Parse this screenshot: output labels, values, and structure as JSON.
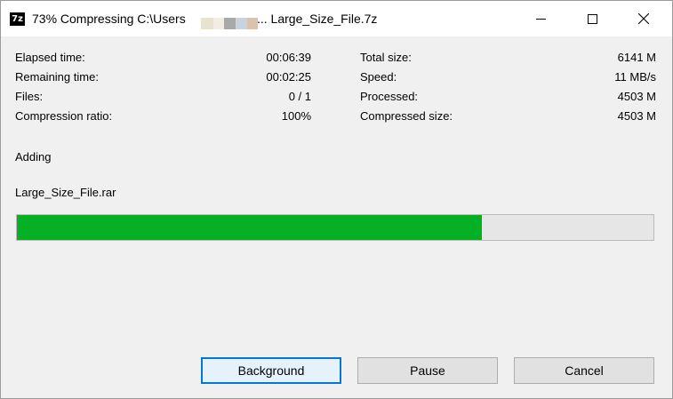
{
  "window": {
    "title_prefix": "73% Compressing C:\\Users",
    "title_suffix": "... Large_Size_File.7z",
    "app_icon_label": "7z",
    "icons": {
      "app": "7zip-app-icon",
      "minimize": "minimize-icon",
      "maximize": "maximize-icon",
      "close": "close-icon"
    }
  },
  "stats": {
    "left": [
      {
        "label": "Elapsed time:",
        "value": "00:06:39"
      },
      {
        "label": "Remaining time:",
        "value": "00:02:25"
      },
      {
        "label": "Files:",
        "value": "0 / 1"
      },
      {
        "label": "Compression ratio:",
        "value": "100%"
      }
    ],
    "right": [
      {
        "label": "Total size:",
        "value": "6141 M"
      },
      {
        "label": "Speed:",
        "value": "11 MB/s"
      },
      {
        "label": "Processed:",
        "value": "4503 M"
      },
      {
        "label": "Compressed size:",
        "value": "4503 M"
      }
    ]
  },
  "operation": "Adding",
  "current_file": "Large_Size_File.rar",
  "progress": {
    "percent": 73,
    "color": "#06b025"
  },
  "buttons": {
    "background": "Background",
    "pause": "Pause",
    "cancel": "Cancel"
  }
}
